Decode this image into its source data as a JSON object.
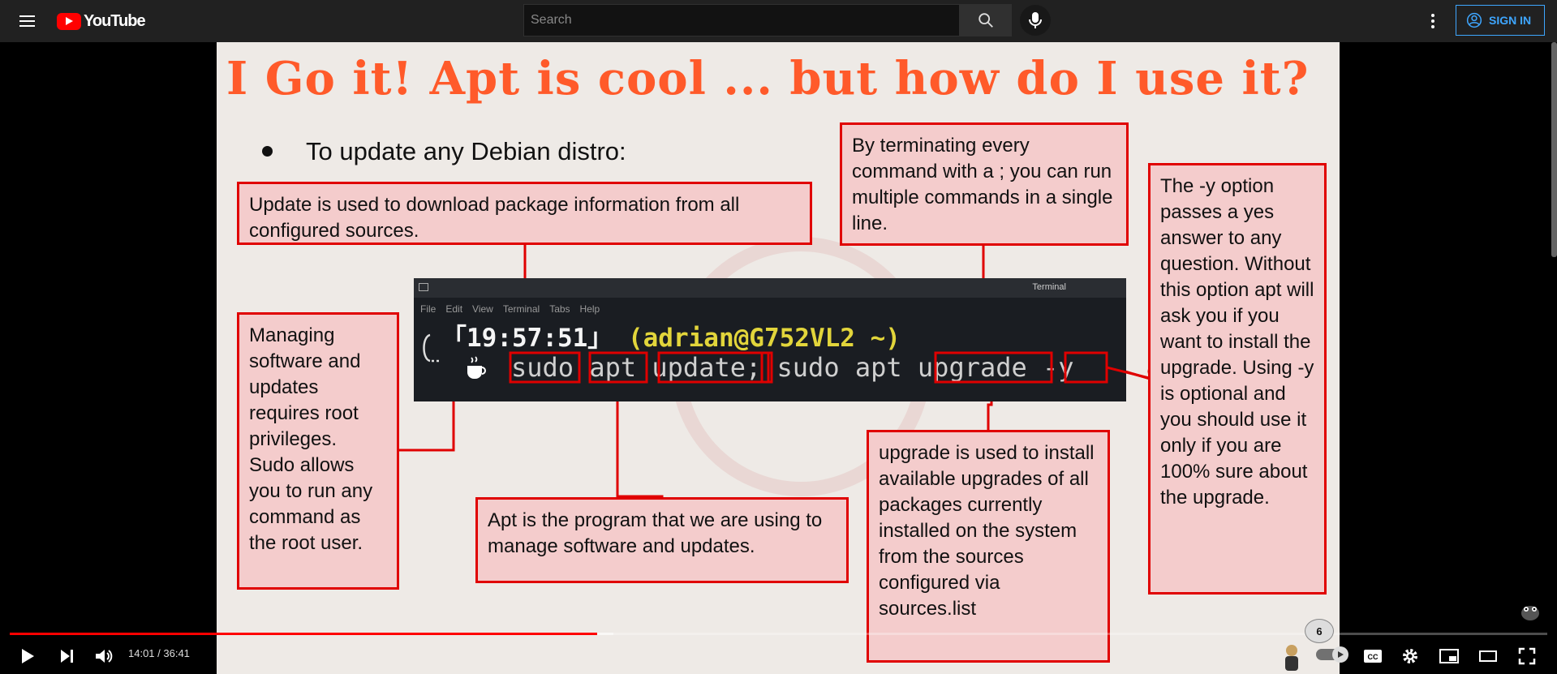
{
  "header": {
    "logo_text": "YouTube",
    "search_placeholder": "Search",
    "signin_label": "SIGN IN"
  },
  "slide": {
    "title": "I Go it! Apt is cool ... but how do I use it?",
    "bullet": "To update any Debian distro:",
    "boxes": {
      "update": "Update is used to download package information from all configured sources.",
      "terminating": "By terminating every command with a ; you can run multiple commands in a single line.",
      "yes_option": "The -y option passes a yes answer to any question. Without this option apt will ask you if you want to install the upgrade. Using -y is optional and you should use it only if you are 100% sure about the upgrade.",
      "sudo": "Managing software and updates requires root privileges. Sudo allows you to run any command as the root user.",
      "apt": "Apt is the program that we are using to manage software and updates.",
      "upgrade": "upgrade is used to install available upgrades of all packages currently installed on the system from the sources configured via sources.list"
    },
    "terminal": {
      "title": "Terminal",
      "menu": [
        "File",
        "Edit",
        "View",
        "Terminal",
        "Tabs",
        "Help"
      ],
      "clock": "「19:57:51」",
      "prompt": "(adrian@G752VL2 ~)",
      "tokens": [
        "sudo",
        "apt",
        "update",
        ";",
        "sudo apt",
        "upgrade",
        "-y"
      ]
    }
  },
  "player": {
    "time": "14:01 / 36:41",
    "progress_fraction": 0.3818,
    "buffer_fraction": 0.3925,
    "bubble_count": "6"
  },
  "colors": {
    "accent_red": "#ff0000",
    "title_orange": "#ff5a2a",
    "box_fill": "#f4cccc",
    "box_border": "#e00000",
    "signin_blue": "#3ea6ff"
  }
}
